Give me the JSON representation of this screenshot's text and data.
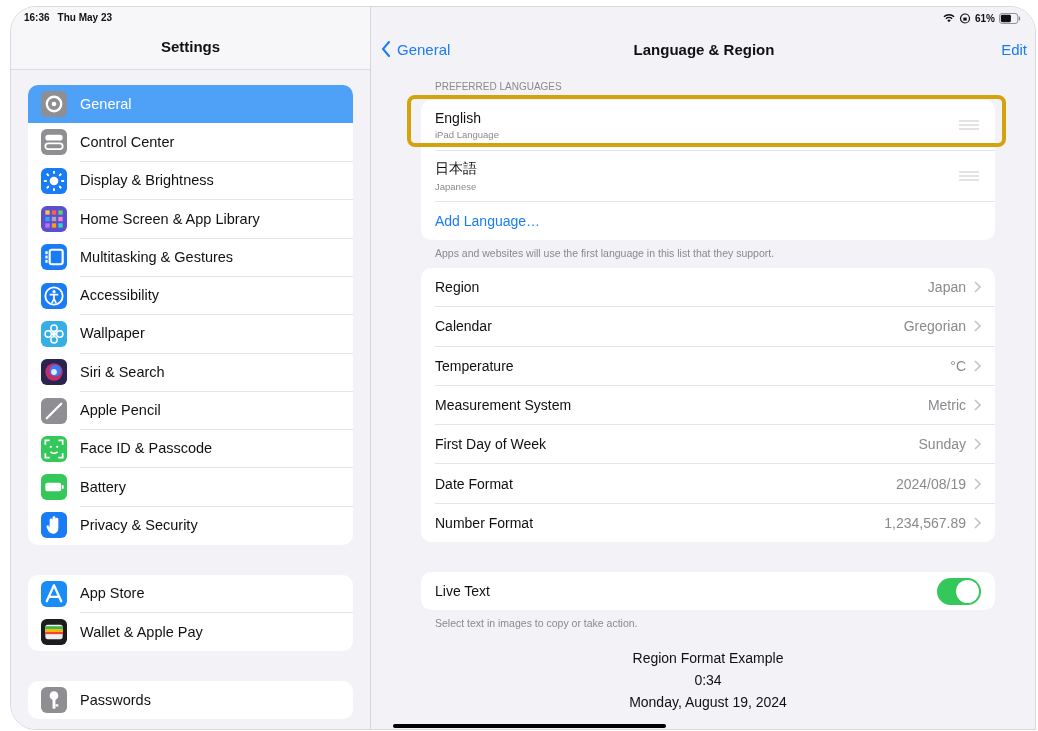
{
  "status_bar": {
    "time": "16:36",
    "date": "Thu May 23",
    "battery": "61%"
  },
  "sidebar": {
    "title": "Settings",
    "groups": [
      {
        "items": [
          {
            "label": "General",
            "color": "#8e8e93",
            "selected": true
          },
          {
            "label": "Control Center",
            "color": "#8e8e93",
            "selected": false
          },
          {
            "label": "Display & Brightness",
            "color": "#1a7cf5",
            "selected": false
          },
          {
            "label": "Home Screen & App Library",
            "color": "#5a4fcf",
            "selected": false
          },
          {
            "label": "Multitasking & Gestures",
            "color": "#1a7cf5",
            "selected": false
          },
          {
            "label": "Accessibility",
            "color": "#1a7cf5",
            "selected": false
          },
          {
            "label": "Wallpaper",
            "color": "#36aee6",
            "selected": false
          },
          {
            "label": "Siri & Search",
            "color": "#2a2550",
            "selected": false
          },
          {
            "label": "Apple Pencil",
            "color": "#8e8e93",
            "selected": false
          },
          {
            "label": "Face ID & Passcode",
            "color": "#34c759",
            "selected": false
          },
          {
            "label": "Battery",
            "color": "#34c759",
            "selected": false
          },
          {
            "label": "Privacy & Security",
            "color": "#1a7cf5",
            "selected": false
          }
        ]
      },
      {
        "items": [
          {
            "label": "App Store",
            "color": "#1a8cf5",
            "selected": false
          },
          {
            "label": "Wallet & Apple Pay",
            "color": "#1c1c1e",
            "selected": false
          }
        ]
      },
      {
        "items": [
          {
            "label": "Passwords",
            "color": "#8e8e93",
            "selected": false
          }
        ]
      }
    ]
  },
  "detail": {
    "back": "General",
    "title": "Language & Region",
    "action": "Edit",
    "languages": {
      "header": "PREFERRED LANGUAGES",
      "items": [
        {
          "name": "English",
          "subtitle": "iPad Language",
          "highlighted": true
        },
        {
          "name": "日本語",
          "subtitle": "Japanese",
          "highlighted": false
        }
      ],
      "add": "Add Language…",
      "footer": "Apps and websites will use the first language in this list that they support."
    },
    "settings": [
      {
        "label": "Region",
        "value": "Japan"
      },
      {
        "label": "Calendar",
        "value": "Gregorian"
      },
      {
        "label": "Temperature",
        "value": "°C"
      },
      {
        "label": "Measurement System",
        "value": "Metric"
      },
      {
        "label": "First Day of Week",
        "value": "Sunday"
      },
      {
        "label": "Date Format",
        "value": "2024/08/19"
      },
      {
        "label": "Number Format",
        "value": "1,234,567.89"
      }
    ],
    "live_text": {
      "label": "Live Text",
      "on": true,
      "footer": "Select text in images to copy or take action."
    },
    "example": {
      "title": "Region Format Example",
      "time": "0:34",
      "date": "Monday, August 19, 2024"
    }
  }
}
